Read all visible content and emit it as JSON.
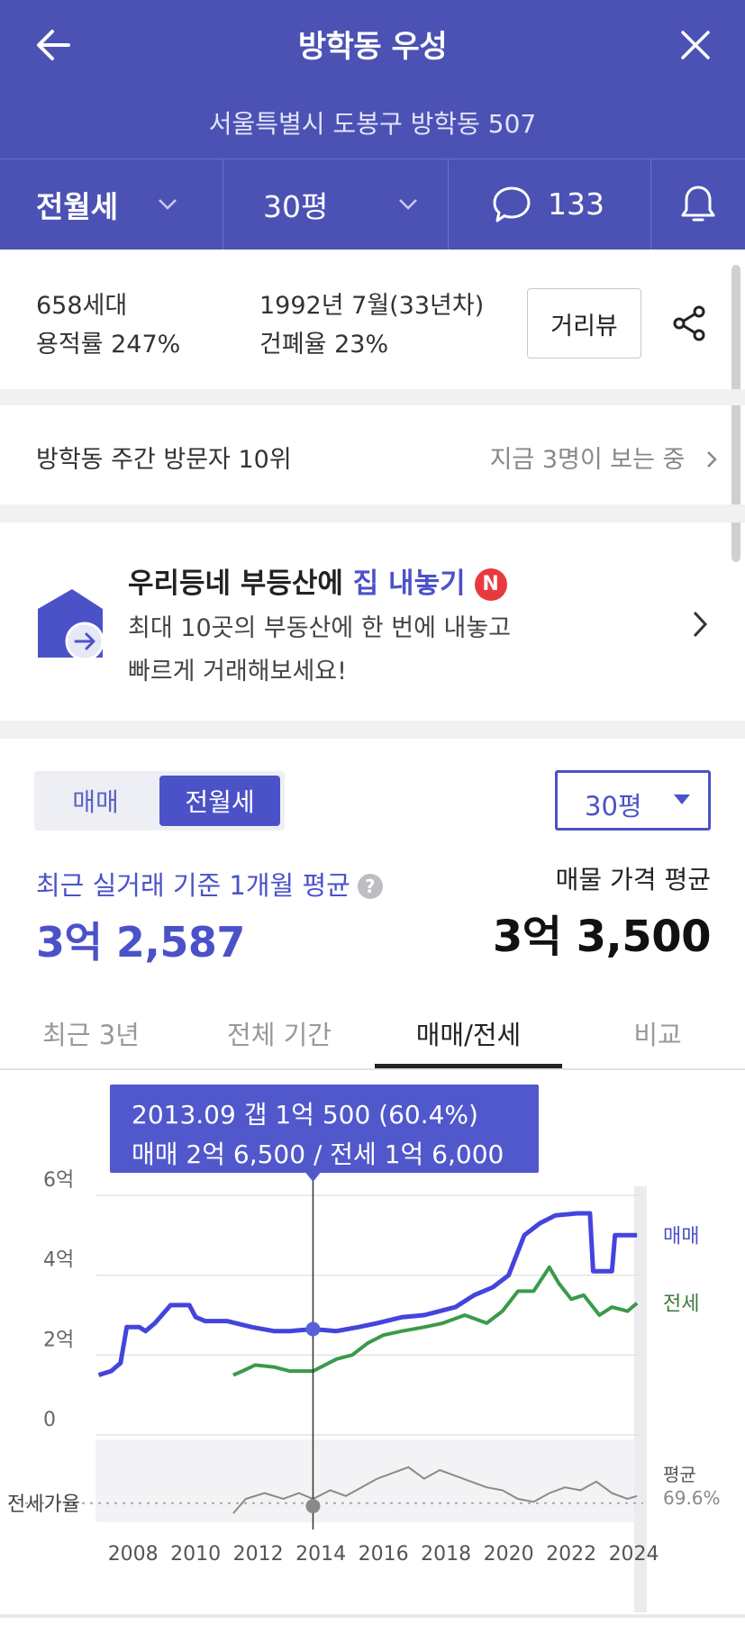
{
  "header": {
    "title": "방학동 우성",
    "address": "서울특별시 도봉구 방학동 507",
    "deal_type": "전월세",
    "size": "30평",
    "comments_count": "133"
  },
  "info": {
    "households": "658세대",
    "floor_area_ratio": "용적률 247%",
    "built": "1992년 7월(33년차)",
    "building_coverage": "건폐율 23%",
    "street_view_button": "거리뷰"
  },
  "visit": {
    "rank": "방학동 주간 방문자 10위",
    "viewers": "지금 3명이 보는 중"
  },
  "promo": {
    "title_prefix": "우리등네 부등산에 ",
    "title_highlight": "집 내놓기",
    "badge": "N",
    "line1": "최대 10곳의 부동산에 한 번에 내놓고",
    "line2": "빠르게 거래해보세요!"
  },
  "price": {
    "toggle_sale": "매매",
    "toggle_rent": "전월세",
    "size_selected": "30평",
    "recent_label": "최근 실거래 기준 1개월 평균",
    "recent_value": "3억 2,587",
    "asking_label": "매물 가격 평균",
    "asking_value": "3억 3,500"
  },
  "tabs": [
    "최근 3년",
    "전체 기간",
    "매매/전세",
    "비교"
  ],
  "tooltip": {
    "line1": "2013.09  갭 1억 500 (60.4%)",
    "line2": "매매 2억 6,500 / 전세 1억 6,000"
  },
  "colors": {
    "brand": "#4b52b4",
    "accent": "#4b52c8",
    "sale_line": "#4444dd",
    "jeonse_line": "#3a9a4a",
    "ratio_line": "#888888"
  },
  "icons": {
    "back": "arrow-left-icon",
    "close": "close-icon",
    "comment": "speech-bubble-icon",
    "bell": "bell-icon",
    "share": "share-icon",
    "promo": "house-arrow-icon"
  },
  "chart_data": {
    "type": "line",
    "y_ticks": [
      "6억",
      "4억",
      "2억",
      "0"
    ],
    "ylim": [
      0,
      6
    ],
    "x_ticks": [
      "2008",
      "2010",
      "2012",
      "2014",
      "2016",
      "2018",
      "2020",
      "2022",
      "2024"
    ],
    "xlim": [
      2006.8,
      2024.3
    ],
    "series": [
      {
        "name": "매매",
        "points": [
          [
            2006.9,
            1.5
          ],
          [
            2007.3,
            1.6
          ],
          [
            2007.6,
            1.8
          ],
          [
            2007.8,
            2.7
          ],
          [
            2008.2,
            2.7
          ],
          [
            2008.4,
            2.6
          ],
          [
            2008.7,
            2.8
          ],
          [
            2009.2,
            3.25
          ],
          [
            2009.8,
            3.25
          ],
          [
            2010.0,
            2.95
          ],
          [
            2010.3,
            2.85
          ],
          [
            2011.0,
            2.85
          ],
          [
            2011.8,
            2.7
          ],
          [
            2012.5,
            2.6
          ],
          [
            2013.0,
            2.6
          ],
          [
            2013.75,
            2.65
          ],
          [
            2014.5,
            2.6
          ],
          [
            2015.2,
            2.7
          ],
          [
            2015.8,
            2.8
          ],
          [
            2016.6,
            2.95
          ],
          [
            2017.3,
            3.0
          ],
          [
            2017.8,
            3.1
          ],
          [
            2018.3,
            3.2
          ],
          [
            2018.9,
            3.5
          ],
          [
            2019.5,
            3.7
          ],
          [
            2020.0,
            4.0
          ],
          [
            2020.5,
            5.0
          ],
          [
            2021.0,
            5.3
          ],
          [
            2021.5,
            5.5
          ],
          [
            2022.2,
            5.55
          ],
          [
            2022.6,
            5.55
          ],
          [
            2022.7,
            4.1
          ],
          [
            2023.3,
            4.1
          ],
          [
            2023.4,
            5.0
          ],
          [
            2024.1,
            5.0
          ]
        ]
      },
      {
        "name": "전세",
        "points": [
          [
            2011.2,
            1.5
          ],
          [
            2011.5,
            1.6
          ],
          [
            2011.9,
            1.75
          ],
          [
            2012.5,
            1.7
          ],
          [
            2013.0,
            1.6
          ],
          [
            2013.75,
            1.6
          ],
          [
            2014.5,
            1.9
          ],
          [
            2015.0,
            2.0
          ],
          [
            2015.5,
            2.3
          ],
          [
            2016.0,
            2.5
          ],
          [
            2016.6,
            2.6
          ],
          [
            2017.3,
            2.7
          ],
          [
            2017.9,
            2.8
          ],
          [
            2018.6,
            3.0
          ],
          [
            2019.3,
            2.8
          ],
          [
            2019.8,
            3.1
          ],
          [
            2020.3,
            3.6
          ],
          [
            2020.8,
            3.6
          ],
          [
            2021.3,
            4.2
          ],
          [
            2021.6,
            3.8
          ],
          [
            2022.0,
            3.4
          ],
          [
            2022.4,
            3.5
          ],
          [
            2022.9,
            3.0
          ],
          [
            2023.3,
            3.2
          ],
          [
            2023.8,
            3.1
          ],
          [
            2024.1,
            3.3
          ]
        ]
      },
      {
        "name": "전세가율",
        "points": [
          [
            2011.2,
            0.0
          ],
          [
            2011.6,
            0.5
          ],
          [
            2012.2,
            0.7
          ],
          [
            2012.8,
            0.5
          ],
          [
            2013.3,
            0.7
          ],
          [
            2013.75,
            0.5
          ],
          [
            2014.3,
            0.8
          ],
          [
            2014.8,
            0.6
          ],
          [
            2015.3,
            0.9
          ],
          [
            2015.8,
            1.2
          ],
          [
            2016.3,
            1.4
          ],
          [
            2016.8,
            1.6
          ],
          [
            2017.3,
            1.2
          ],
          [
            2017.8,
            1.5
          ],
          [
            2018.3,
            1.3
          ],
          [
            2018.8,
            1.1
          ],
          [
            2019.3,
            0.9
          ],
          [
            2019.8,
            0.8
          ],
          [
            2020.3,
            0.5
          ],
          [
            2020.8,
            0.4
          ],
          [
            2021.3,
            0.7
          ],
          [
            2021.8,
            0.9
          ],
          [
            2022.3,
            0.8
          ],
          [
            2022.8,
            1.1
          ],
          [
            2023.3,
            0.7
          ],
          [
            2023.8,
            0.5
          ],
          [
            2024.1,
            0.6
          ]
        ]
      }
    ],
    "series_labels": [
      "매매",
      "전세"
    ],
    "ratio_label": "전세가율",
    "avg_label": "평균",
    "avg_value": "69.6%",
    "highlight_year": 2013.75
  }
}
